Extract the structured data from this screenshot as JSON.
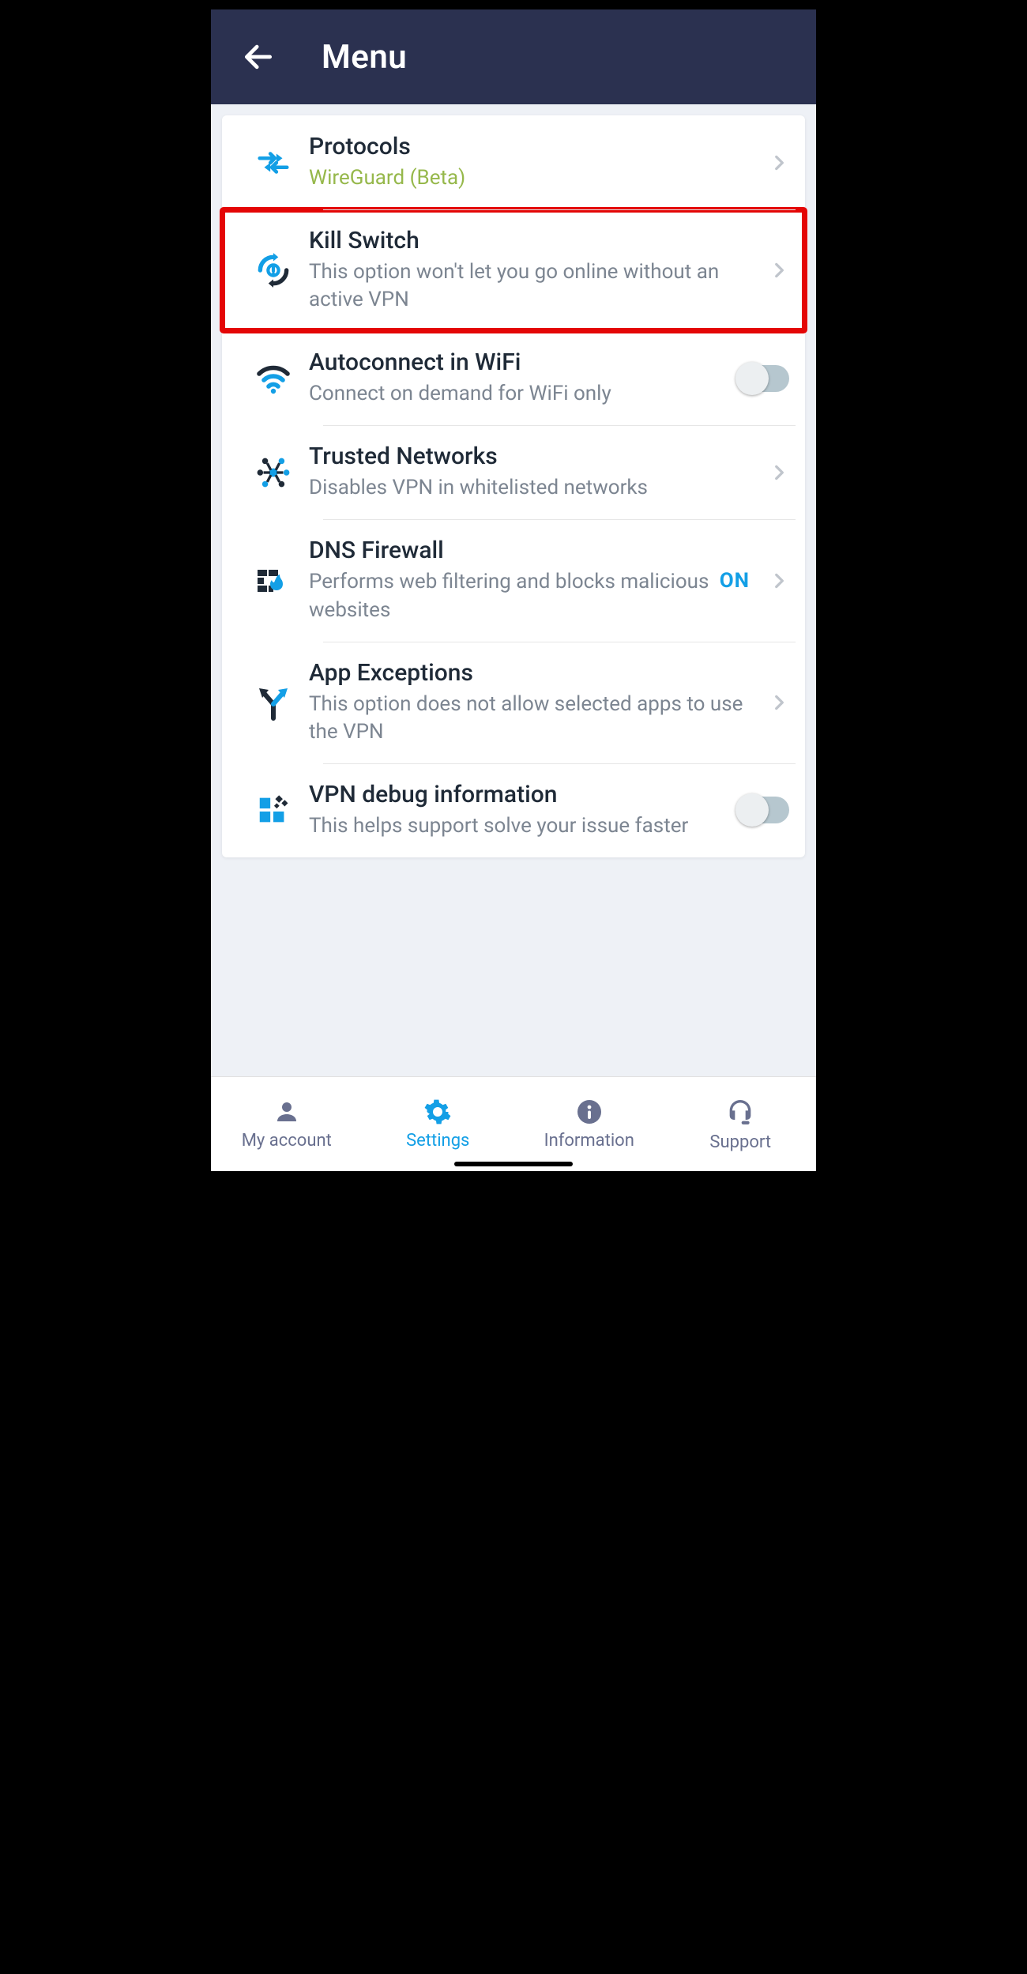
{
  "header": {
    "title": "Menu"
  },
  "items": {
    "protocols": {
      "title": "Protocols",
      "sub": "WireGuard (Beta)"
    },
    "killswitch": {
      "title": "Kill Switch",
      "sub": "This option won't let you go online without an active VPN"
    },
    "autoconnect": {
      "title": "Autoconnect in WiFi",
      "sub": "Connect on demand for WiFi only"
    },
    "trusted": {
      "title": "Trusted Networks",
      "sub": "Disables VPN in whitelisted networks"
    },
    "dnsfw": {
      "title": "DNS Firewall",
      "sub": "Performs web filtering and blocks malicious websites",
      "status": "ON"
    },
    "appexc": {
      "title": "App Exceptions",
      "sub": "This option does not allow selected apps to use the VPN"
    },
    "debug": {
      "title": "VPN debug information",
      "sub": "This helps support solve your issue faster"
    }
  },
  "tabs": {
    "account": "My account",
    "settings": "Settings",
    "info": "Information",
    "support": "Support"
  }
}
